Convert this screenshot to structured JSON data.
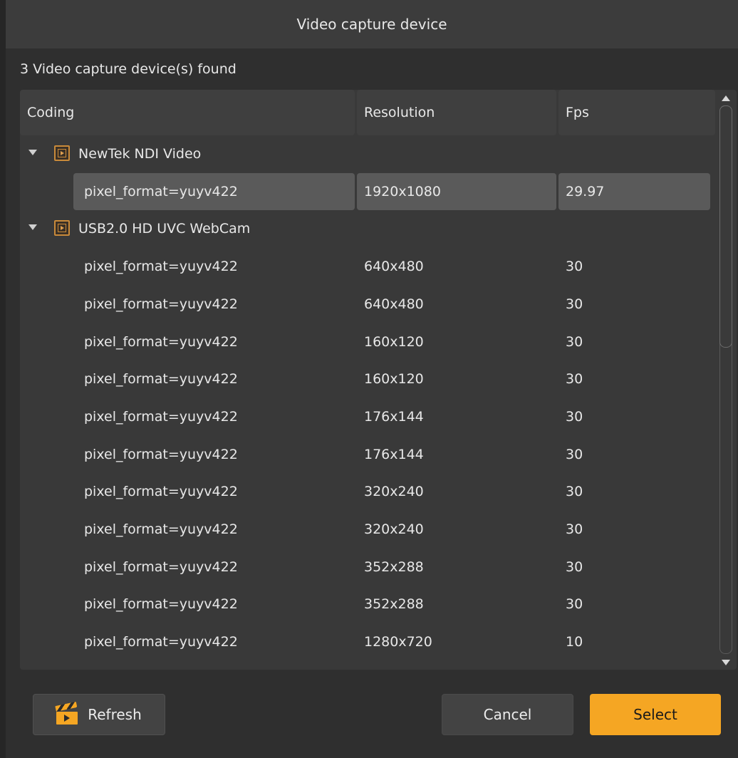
{
  "window": {
    "title": "Video capture device"
  },
  "status": {
    "found_text": "3 Video capture device(s) found"
  },
  "table": {
    "columns": [
      "Coding",
      "Resolution",
      "Fps"
    ],
    "devices": [
      {
        "name": "NewTek NDI Video",
        "expanded": true,
        "icon": "video-device-icon",
        "formats": [
          {
            "coding": "pixel_format=yuyv422",
            "resolution": "1920x1080",
            "fps": "29.97",
            "selected": true
          }
        ]
      },
      {
        "name": "USB2.0 HD UVC WebCam",
        "expanded": true,
        "icon": "video-device-icon",
        "formats": [
          {
            "coding": "pixel_format=yuyv422",
            "resolution": "640x480",
            "fps": "30"
          },
          {
            "coding": "pixel_format=yuyv422",
            "resolution": "640x480",
            "fps": "30"
          },
          {
            "coding": "pixel_format=yuyv422",
            "resolution": "160x120",
            "fps": "30"
          },
          {
            "coding": "pixel_format=yuyv422",
            "resolution": "160x120",
            "fps": "30"
          },
          {
            "coding": "pixel_format=yuyv422",
            "resolution": "176x144",
            "fps": "30"
          },
          {
            "coding": "pixel_format=yuyv422",
            "resolution": "176x144",
            "fps": "30"
          },
          {
            "coding": "pixel_format=yuyv422",
            "resolution": "320x240",
            "fps": "30"
          },
          {
            "coding": "pixel_format=yuyv422",
            "resolution": "320x240",
            "fps": "30"
          },
          {
            "coding": "pixel_format=yuyv422",
            "resolution": "352x288",
            "fps": "30"
          },
          {
            "coding": "pixel_format=yuyv422",
            "resolution": "352x288",
            "fps": "30"
          },
          {
            "coding": "pixel_format=yuyv422",
            "resolution": "1280x720",
            "fps": "10"
          }
        ]
      }
    ]
  },
  "buttons": {
    "refresh_label": "Refresh",
    "cancel_label": "Cancel",
    "select_label": "Select"
  },
  "colors": {
    "accent": "#f5a623",
    "selection": "#5a5a5a",
    "background": "#2f2f2f"
  }
}
